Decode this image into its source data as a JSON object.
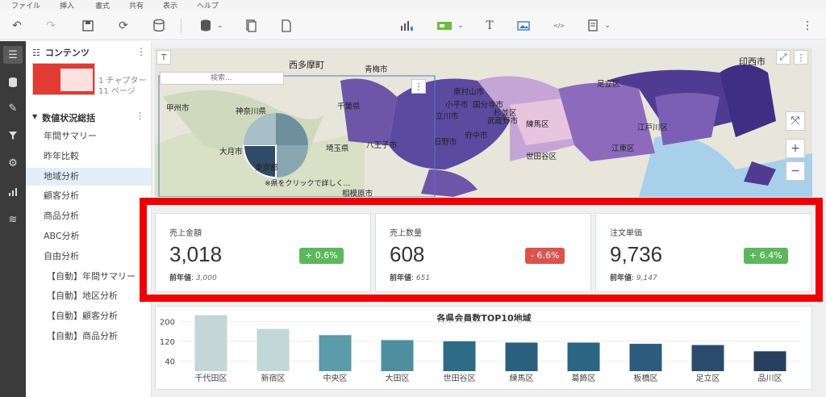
{
  "menu": [
    "ファイル",
    "挿入",
    "書式",
    "共有",
    "表示",
    "ヘルプ"
  ],
  "panel": {
    "title": "コンテンツ",
    "thumb_info": [
      "1 チャプター",
      "11 ページ"
    ],
    "section": "数値状況総括",
    "items": [
      {
        "label": "年間サマリー",
        "active": false,
        "sub": false
      },
      {
        "label": "昨年比較",
        "active": false,
        "sub": false
      },
      {
        "label": "地域分析",
        "active": true,
        "sub": false
      },
      {
        "label": "顧客分析",
        "active": false,
        "sub": false
      },
      {
        "label": "商品分析",
        "active": false,
        "sub": false
      },
      {
        "label": "ABC分析",
        "active": false,
        "sub": false
      },
      {
        "label": "自由分析",
        "active": false,
        "sub": false
      },
      {
        "label": "【自動】年間サマリー",
        "active": false,
        "sub": true
      },
      {
        "label": "【自動】地区分析",
        "active": false,
        "sub": true
      },
      {
        "label": "【自動】顧客分析",
        "active": false,
        "sub": true
      },
      {
        "label": "【自動】商品分析",
        "active": false,
        "sub": true
      }
    ]
  },
  "map": {
    "search_placeholder": "検索...",
    "hint": "※県をクリックで詳しく…",
    "labels": [
      "西多摩町",
      "青梅市",
      "甲州市",
      "神奈川県",
      "千葉県",
      "大月市",
      "東京都",
      "埼玉県",
      "八王子市",
      "相模原市",
      "立川市",
      "日野市",
      "府中市",
      "世田谷区",
      "江戸川区",
      "江東区",
      "足立区",
      "印西市",
      "練馬区",
      "杉並区",
      "東村山市",
      "小平市",
      "国分寺市",
      "武蔵野市"
    ]
  },
  "kpis": [
    {
      "label": "売上金額",
      "value": "3,018",
      "change": "+ 0.6%",
      "trend": "up",
      "prev_label": "前年値",
      "prev_value": "3,000"
    },
    {
      "label": "売上数量",
      "value": "608",
      "change": "- 6.6%",
      "trend": "down",
      "prev_label": "前年値",
      "prev_value": "651"
    },
    {
      "label": "注文単価",
      "value": "9,736",
      "change": "+ 6.4%",
      "trend": "up",
      "prev_label": "前年値",
      "prev_value": "9,147"
    }
  ],
  "colors": {
    "up": "#5cb85c",
    "down": "#d9534f",
    "highlight": "#ee0000",
    "accent": "#e2eef9"
  },
  "chart_data": {
    "type": "bar",
    "title": "各県会員数TOP10地域",
    "categories": [
      "千代田区",
      "新宿区",
      "中央区",
      "大田区",
      "世田谷区",
      "練馬区",
      "葛飾区",
      "板橋区",
      "足立区",
      "品川区"
    ],
    "values": [
      225,
      170,
      145,
      125,
      120,
      115,
      115,
      110,
      105,
      80
    ],
    "yticks": [
      40,
      120,
      200
    ],
    "ylim": [
      0,
      240
    ],
    "colors": [
      "#c5d6d6",
      "#c2d7d8",
      "#5c9ba8",
      "#4f8e9f",
      "#2c6c86",
      "#2a5f7e",
      "#2c6581",
      "#2b5c7d",
      "#2a4b6b",
      "#283f60"
    ]
  }
}
